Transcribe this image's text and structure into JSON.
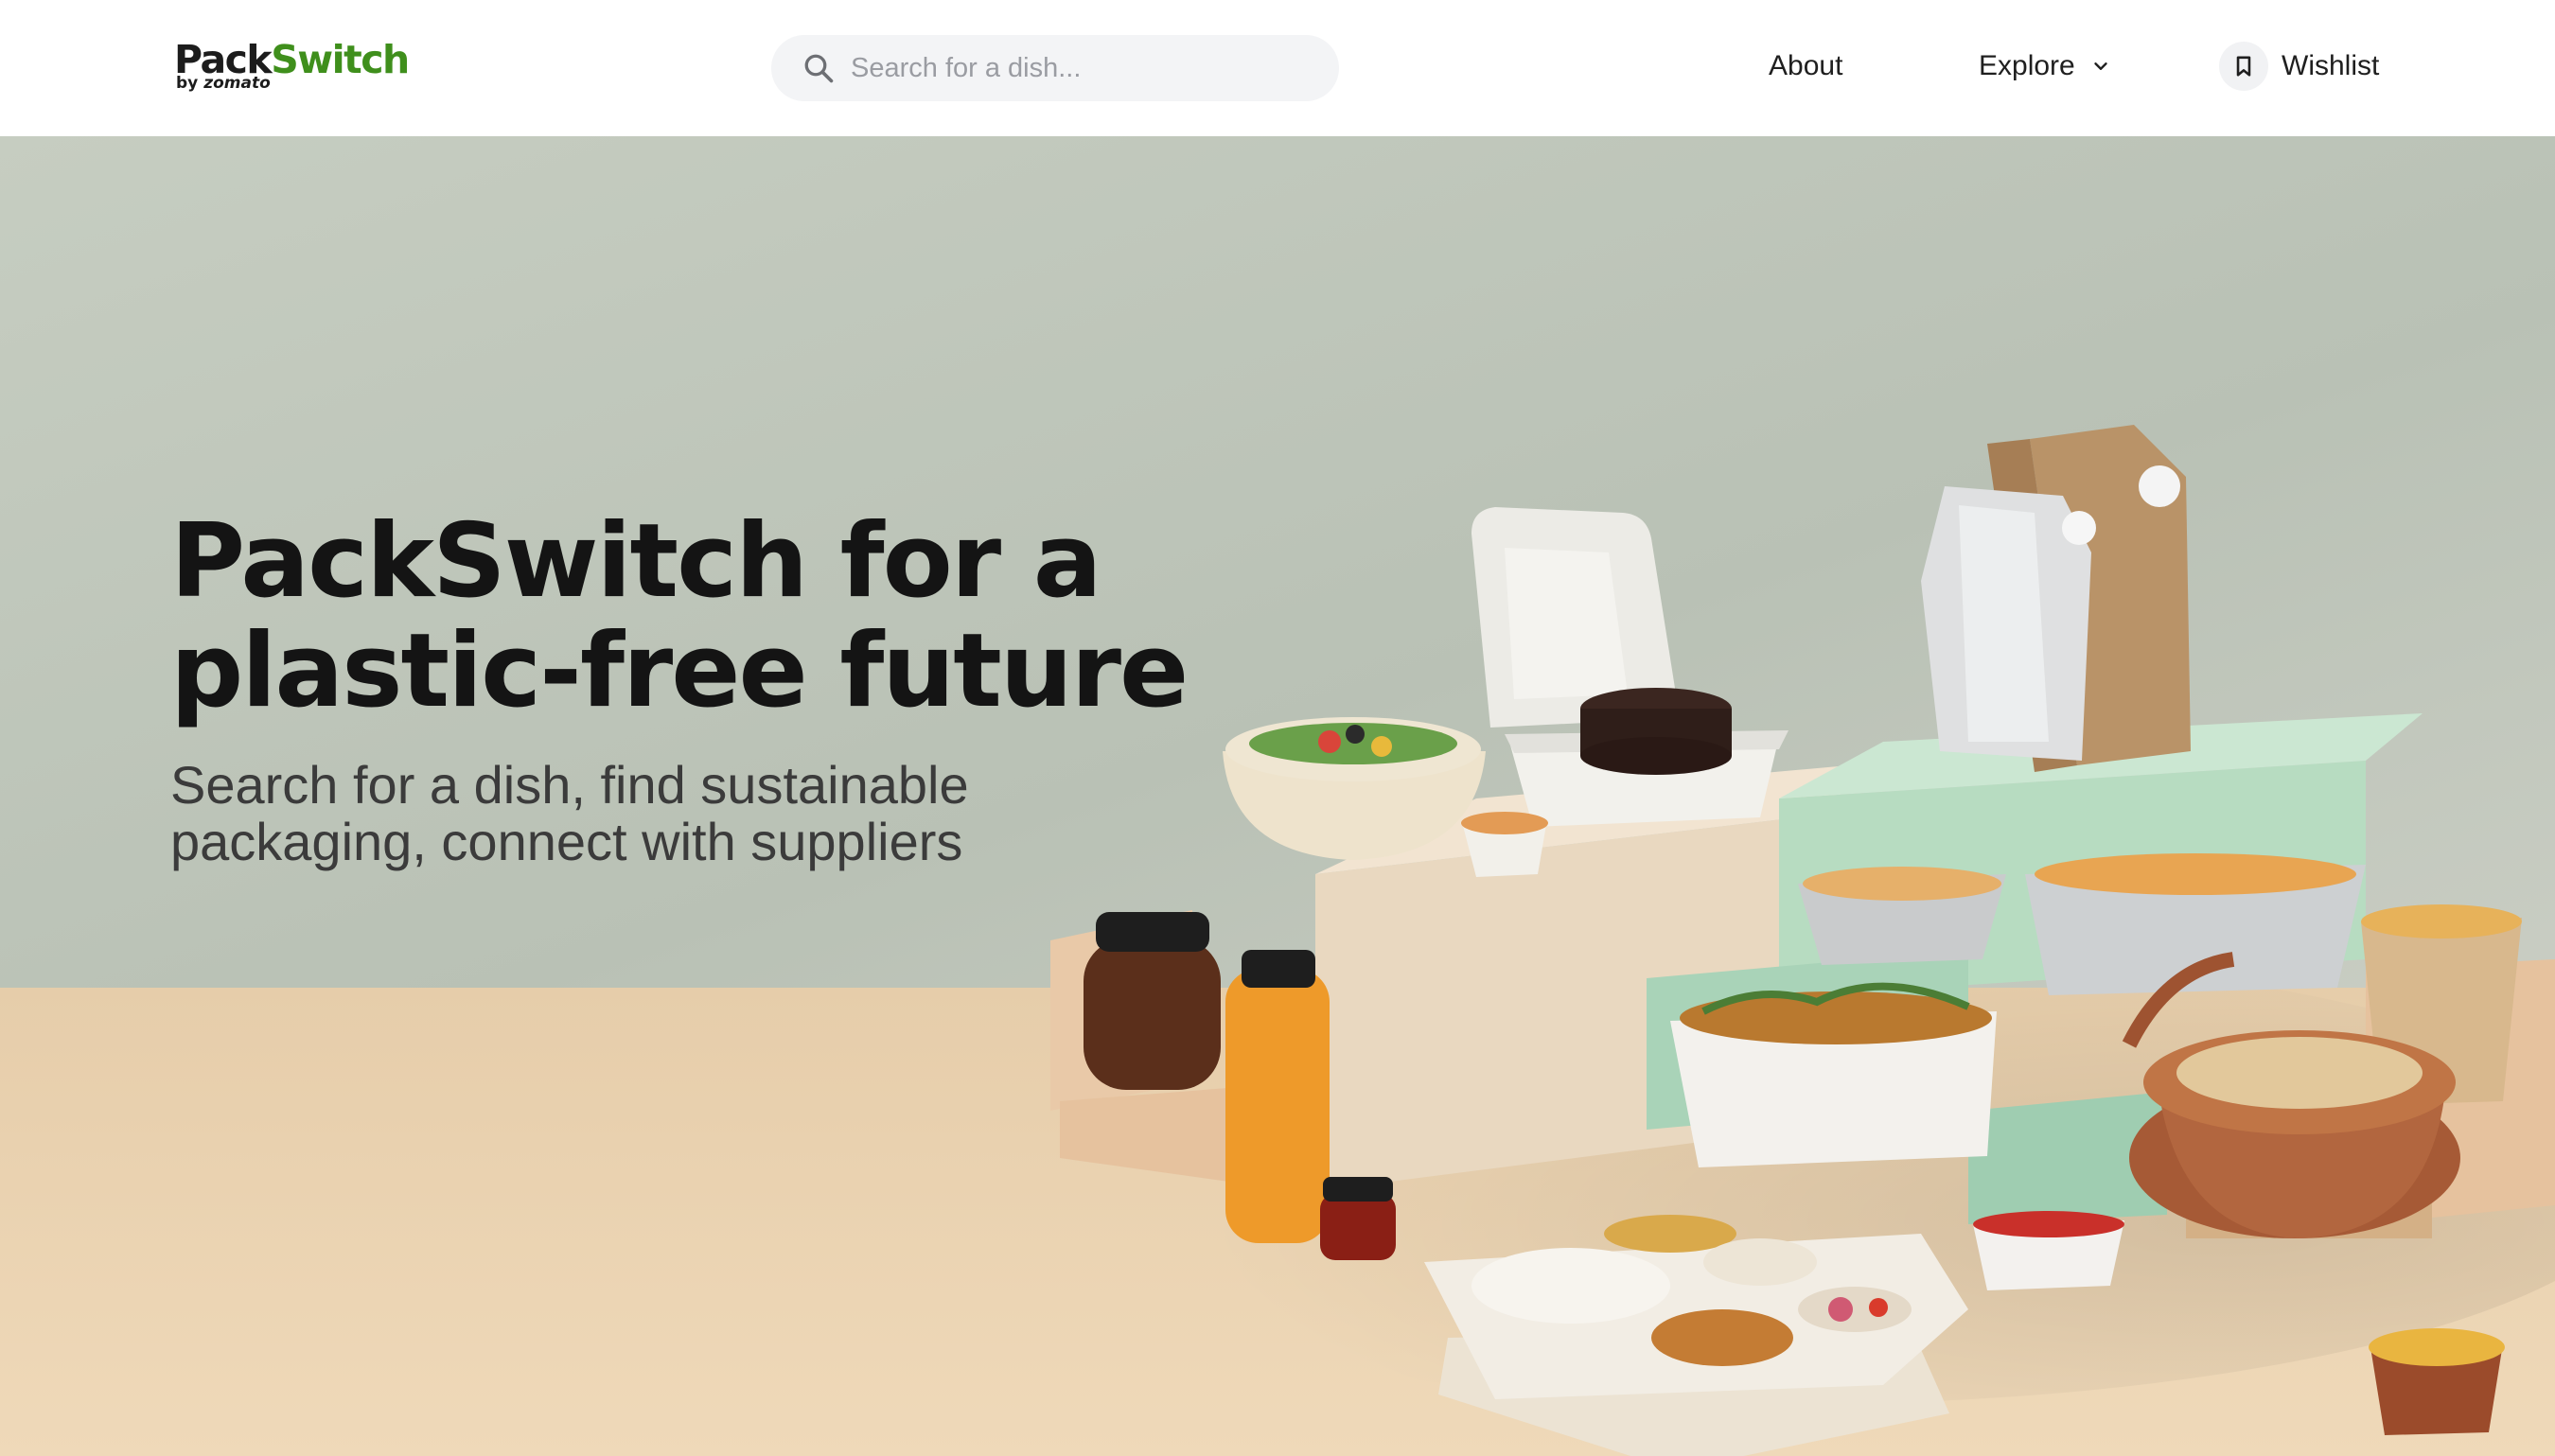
{
  "header": {
    "logo": {
      "primary_a": "Pack",
      "primary_b": "Switch",
      "by": "by",
      "brand": "zomato"
    },
    "search": {
      "placeholder": "Search for a dish...",
      "value": ""
    },
    "nav": {
      "about": "About",
      "explore": "Explore",
      "wishlist": "Wishlist"
    }
  },
  "hero": {
    "title_line1": "PackSwitch for a",
    "title_line2": "plastic-free future",
    "subtitle_line1": "Search for a dish, find sustainable",
    "subtitle_line2": "packaging, connect with suppliers"
  },
  "colors": {
    "brand_green": "#3f8f1c",
    "wall": "#c3cbbf",
    "floor": "#ecd5b4",
    "text_dark": "#141414"
  },
  "icons": [
    "search-icon",
    "chevron-down-icon",
    "bookmark-icon"
  ]
}
